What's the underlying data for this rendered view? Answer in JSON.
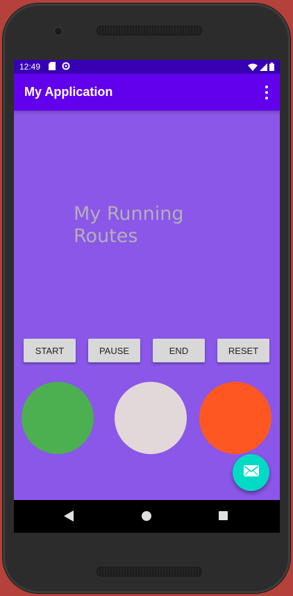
{
  "status_bar": {
    "time": "12:49",
    "left_icons": [
      "sd-card-icon",
      "data-saver-icon"
    ],
    "right_icons": [
      "wifi-icon",
      "signal-icon",
      "battery-icon"
    ]
  },
  "app_bar": {
    "title": "My Application",
    "menu_icon": "overflow-menu-icon"
  },
  "main": {
    "heading": "My Running Routes",
    "buttons": [
      {
        "label": "START"
      },
      {
        "label": "PAUSE"
      },
      {
        "label": "END"
      },
      {
        "label": "RESET"
      }
    ],
    "circles": [
      {
        "color": "#4caf50"
      },
      {
        "color": "#e3d8d9"
      },
      {
        "color": "#ff5722"
      }
    ],
    "fab_icon": "mail-icon"
  },
  "colors": {
    "status_bar": "#3700b3",
    "app_bar": "#6200ee",
    "background": "#8a57e8",
    "fab": "#03dac5"
  },
  "nav_bar": [
    "back-icon",
    "home-icon",
    "recents-icon"
  ]
}
